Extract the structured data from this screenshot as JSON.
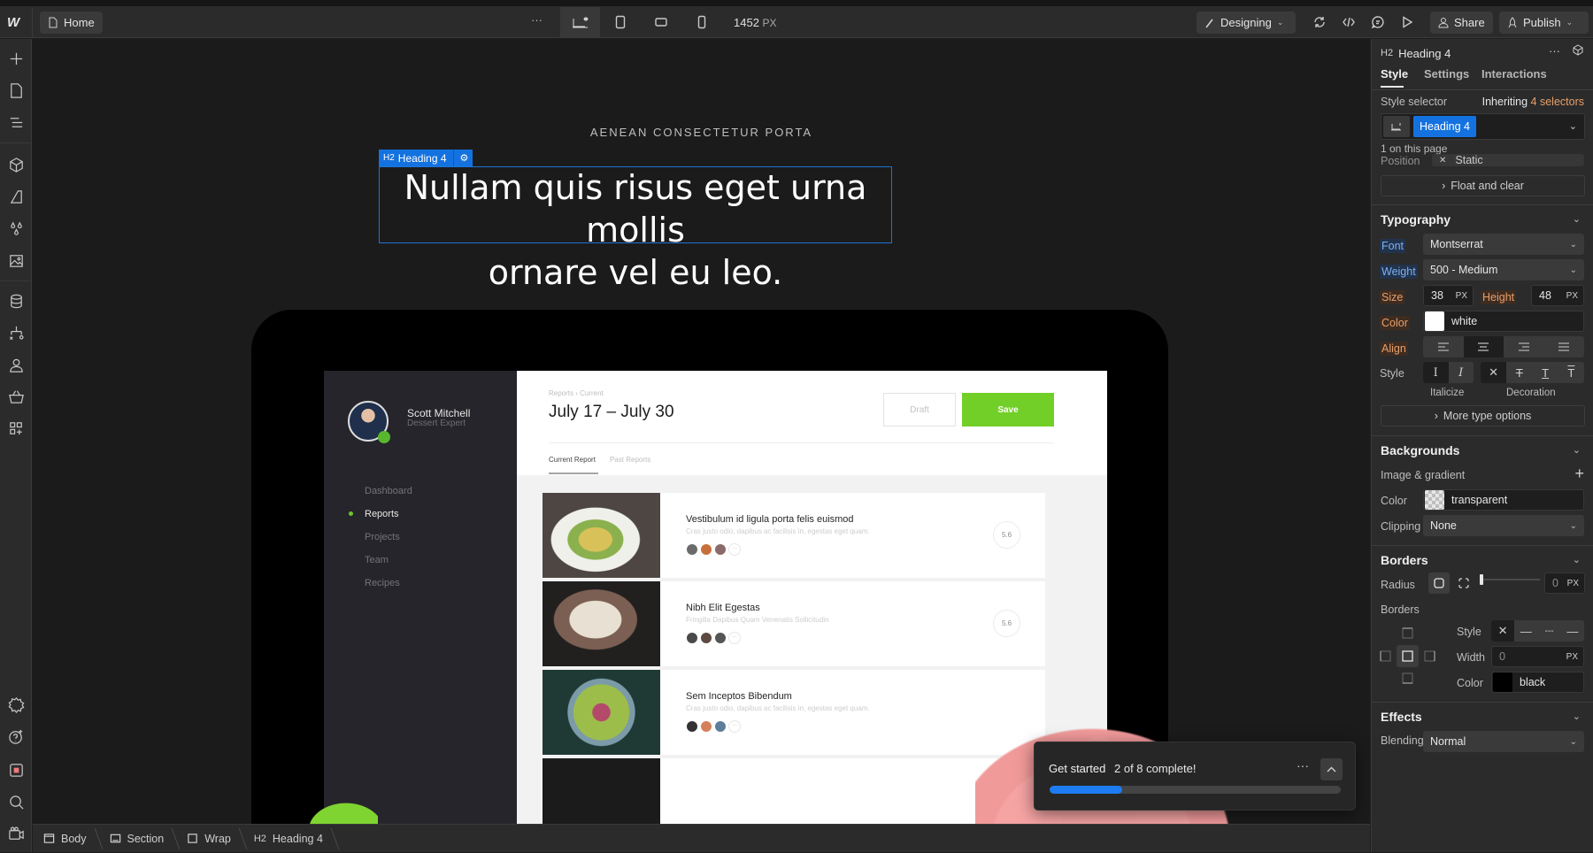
{
  "topbar": {
    "page_label": "Home",
    "more_label": "···",
    "breakpoint_width": "1452",
    "breakpoint_unit": "PX",
    "mode_label": "Designing",
    "share_label": "Share",
    "publish_label": "Publish"
  },
  "canvas": {
    "eyebrow": "AENEAN CONSECTETUR PORTA",
    "heading_line1": "Nullam quis risus eget urna mollis",
    "heading_line2": "ornare vel eu leo.",
    "selection_tag": {
      "tag": "H2",
      "label": "Heading 4"
    },
    "mockup": {
      "user_name": "Scott Mitchell",
      "user_role": "Dessert Expert",
      "nav": [
        "Dashboard",
        "Reports",
        "Projects",
        "Team",
        "Recipes"
      ],
      "nav_active": "Reports",
      "breadcrumb": "Reports  ›  Current",
      "date_range": "July 17 – July 30",
      "draft_label": "Draft",
      "save_label": "Save",
      "tabs": [
        "Current Report",
        "Past Reports"
      ],
      "cards": [
        {
          "title": "Vestibulum id ligula porta felis euismod",
          "subtitle": "Cras justo odio, dapibus ac facilisis in, egestas eget quam.",
          "score": "5.6"
        },
        {
          "title": "Nibh Elit Egestas",
          "subtitle": "Fringilla Dapibus Quam Venenatis Sollicitudin",
          "score": "5.6"
        },
        {
          "title": "Sem Inceptos Bibendum",
          "subtitle": "Cras justo odio, dapibus ac facilisis in, egestas eget quam.",
          "score": ""
        }
      ],
      "more_label": "···",
      "accent_color": "#72cf27"
    }
  },
  "get_started": {
    "title": "Get started",
    "status": "2 of 8 complete!",
    "completed": 2,
    "total": 8,
    "more_label": "···"
  },
  "breadcrumb": [
    {
      "icon": "body-icon",
      "label": "Body"
    },
    {
      "icon": "section-icon",
      "label": "Section"
    },
    {
      "icon": "div-icon",
      "label": "Wrap"
    },
    {
      "icon": "h2-icon",
      "tag": "H2",
      "label": "Heading 4"
    }
  ],
  "panel": {
    "element_tag": "H2",
    "element_name": "Heading 4",
    "more_label": "···",
    "tabs": [
      "Style",
      "Settings",
      "Interactions"
    ],
    "active_tab": "Style",
    "style_selector_label": "Style selector",
    "inheriting_prefix": "Inheriting",
    "inheriting_count": "4 selectors",
    "selector_chip": "Heading 4",
    "on_page": "1 on this page",
    "position_label": "Position",
    "position_value": "Static",
    "float_clear": "Float and clear",
    "typography": {
      "title": "Typography",
      "font_label": "Font",
      "font_value": "Montserrat",
      "weight_label": "Weight",
      "weight_value": "500 - Medium",
      "size_label": "Size",
      "size_value": "38",
      "size_unit": "PX",
      "height_label": "Height",
      "height_value": "48",
      "height_unit": "PX",
      "color_label": "Color",
      "color_value": "white",
      "color_hex": "#ffffff",
      "align_label": "Align",
      "align_active": "center",
      "style_label": "Style",
      "italicize_label": "Italicize",
      "decoration_label": "Decoration",
      "more_options": "More type options"
    },
    "backgrounds": {
      "title": "Backgrounds",
      "image_gradient_label": "Image & gradient",
      "color_label": "Color",
      "color_value": "transparent",
      "clipping_label": "Clipping",
      "clipping_value": "None"
    },
    "borders": {
      "title": "Borders",
      "radius_label": "Radius",
      "radius_value": "0",
      "radius_unit": "PX",
      "borders_label": "Borders",
      "style_label": "Style",
      "width_label": "Width",
      "width_value": "0",
      "width_unit": "PX",
      "color_label": "Color",
      "color_value": "black",
      "color_hex": "#000000"
    },
    "effects": {
      "title": "Effects",
      "blending_label": "Blending",
      "blending_value": "Normal"
    }
  },
  "colors": {
    "selection_blue": "#1472e0",
    "progress_blue": "#1d7cf2",
    "label_blue": "#7fb0f0",
    "label_orange": "#e8a06a"
  }
}
